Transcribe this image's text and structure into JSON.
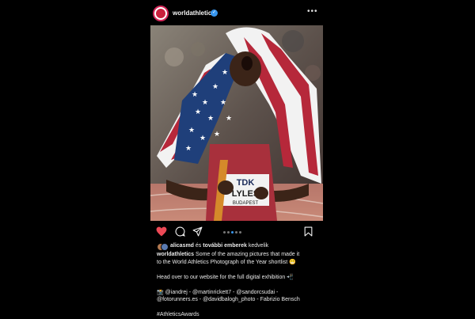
{
  "post": {
    "username": "worldathletics",
    "verified_mark": "✓",
    "more_icon": "•••",
    "icons": [
      "heart-icon",
      "comment-icon",
      "share-icon",
      "bookmark-icon",
      "more-icon",
      "verified-badge-icon"
    ],
    "colors": {
      "heart": "#ed4956",
      "background": "#000000",
      "verified": "#3897f0",
      "active_dot": "#3897f0"
    },
    "photo": {
      "bib_line1": "TDK",
      "bib_line2": "LYLES",
      "bib_line3": "BUDAPEST"
    },
    "carousel": {
      "count": 5,
      "active_index": 2
    },
    "likes": {
      "user": "alicasmd",
      "middle": " és ",
      "others": "további emberek",
      "suffix": " kedvelik"
    },
    "caption": {
      "user": "worldathletics",
      "line1": " Some of the amazing pictures that made it",
      "line2": "to the World Athletics Photograph of the Year shortlist 😁",
      "line3": "Head over to our website for the full digital exhibition 📲",
      "line4": "📸 @iandrej - @martinrickett7 - @sandorcsudai -",
      "line5": "@fotorunners.es - @davidbalogh_photo - Fabrizio Bensch",
      "line6": "#AthleticsAwards"
    }
  }
}
